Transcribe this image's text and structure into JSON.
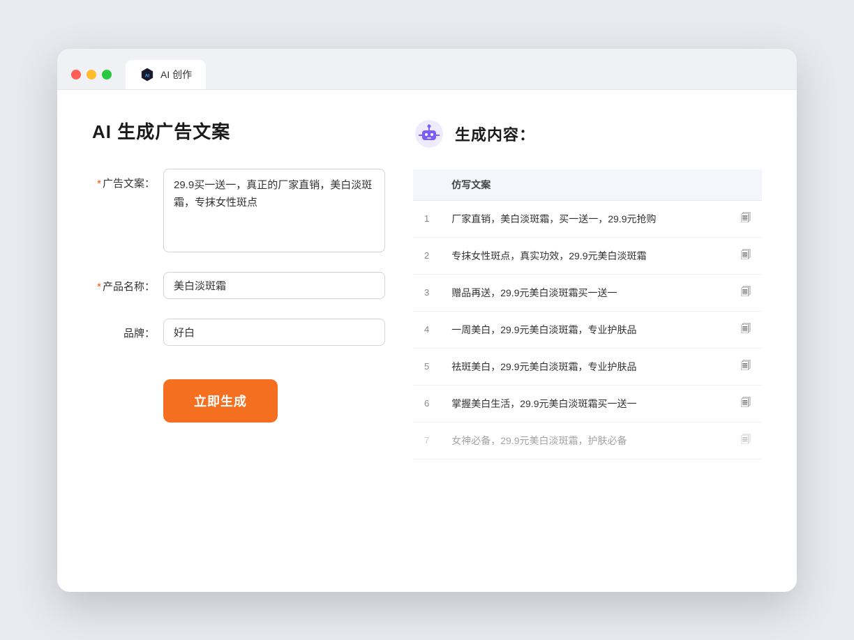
{
  "window": {
    "tab_label": "AI 创作"
  },
  "page": {
    "title": "AI 生成广告文案"
  },
  "form": {
    "ad_copy_label": "广告文案：",
    "ad_copy_required": "*",
    "ad_copy_value": "29.9买一送一，真正的厂家直销，美白淡斑霜，专抹女性斑点",
    "product_name_label": "产品名称：",
    "product_name_required": "*",
    "product_name_value": "美白淡斑霜",
    "brand_label": "品牌：",
    "brand_value": "好白",
    "generate_button": "立即生成"
  },
  "results": {
    "header_icon_alt": "robot-icon",
    "header_title": "生成内容：",
    "column_label": "仿写文案",
    "items": [
      {
        "num": 1,
        "text": "厂家直销，美白淡斑霜，买一送一，29.9元抢购"
      },
      {
        "num": 2,
        "text": "专抹女性斑点，真实功效，29.9元美白淡斑霜"
      },
      {
        "num": 3,
        "text": "赠品再送，29.9元美白淡斑霜买一送一"
      },
      {
        "num": 4,
        "text": "一周美白，29.9元美白淡斑霜，专业护肤品"
      },
      {
        "num": 5,
        "text": "祛斑美白，29.9元美白淡斑霜，专业护肤品"
      },
      {
        "num": 6,
        "text": "掌握美白生活，29.9元美白淡斑霜买一送一"
      },
      {
        "num": 7,
        "text": "女神必备，29.9元美白淡斑霜，护肤必备"
      }
    ]
  }
}
